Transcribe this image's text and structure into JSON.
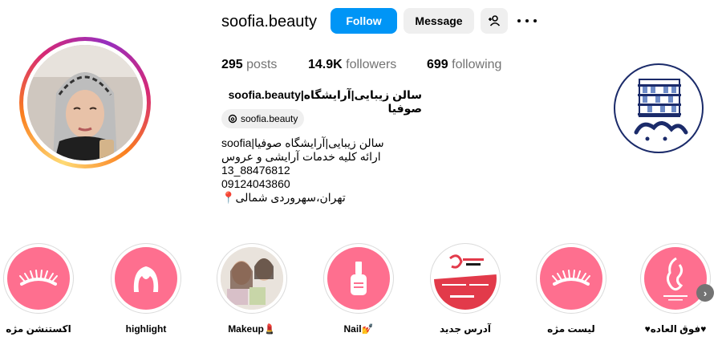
{
  "profile": {
    "username": "soofia.beauty",
    "follow_label": "Follow",
    "message_label": "Message",
    "posts_count": "295",
    "posts_label": "posts",
    "followers_count": "14.9K",
    "followers_label": "followers",
    "following_count": "699",
    "following_label": "following",
    "full_name": "soofia.beauty|سالن زیبایی|آرایشگاه صوفیا",
    "threads_handle": "soofia.beauty",
    "bio": [
      "soofia|سالن زیبایی|آرایشگاه صوفیا",
      "ارائه کلیه خدمات آرایشی و عروس",
      "13_88476812",
      "09124043860",
      "📍تهران،سهروردی شمالی"
    ]
  },
  "highlights": [
    {
      "label": "اکستنشن مژه",
      "icon": "eyelash-icon"
    },
    {
      "label": "highlight",
      "icon": "hair-icon"
    },
    {
      "label": "Makeup💄",
      "icon": "photo-thumbnail"
    },
    {
      "label": "Nail💅",
      "icon": "nail-polish-icon"
    },
    {
      "label": "آدرس جدید",
      "icon": "brand-card"
    },
    {
      "label": "لیست مژه",
      "icon": "eyelash-icon"
    },
    {
      "label": "♥فوق العاده♥",
      "icon": "soofia-logo"
    }
  ],
  "colors": {
    "follow": "#0095f6",
    "highlight_pink": "#fe6f8f",
    "logo_blue": "#1b2b6a"
  }
}
